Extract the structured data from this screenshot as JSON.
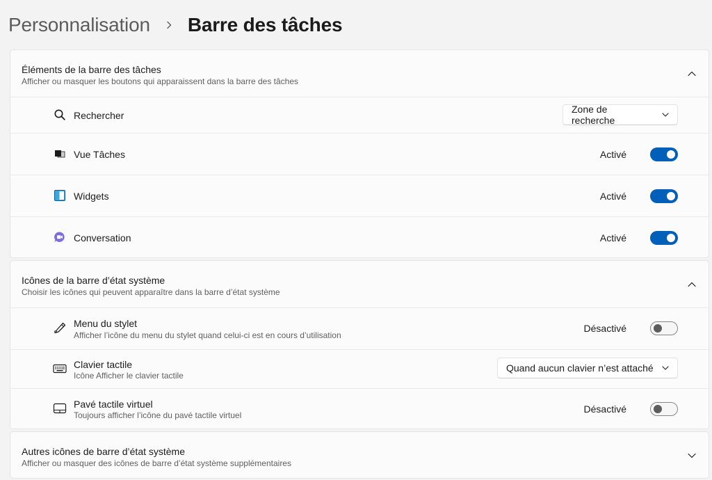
{
  "breadcrumb": {
    "parent": "Personnalisation",
    "current": "Barre des tâches"
  },
  "colors": {
    "accent": "#005fb8",
    "background": "#f3f3f3",
    "card": "#fbfbfb"
  },
  "sections": {
    "taskbar_items": {
      "title": "Éléments de la barre des tâches",
      "description": "Afficher ou masquer les boutons qui apparaissent dans la barre des tâches",
      "expanded": true,
      "rows": {
        "search": {
          "icon": "search-icon",
          "label": "Rechercher",
          "value": "Zone de recherche"
        },
        "task_view": {
          "icon": "task-view-icon",
          "label": "Vue Tâches",
          "state": "Activé",
          "on": true
        },
        "widgets": {
          "icon": "widgets-icon",
          "label": "Widgets",
          "state": "Activé",
          "on": true
        },
        "chat": {
          "icon": "chat-icon",
          "label": "Conversation",
          "state": "Activé",
          "on": true
        }
      }
    },
    "system_tray_icons": {
      "title": "Icônes de la barre d’état système",
      "description": "Choisir les icônes qui peuvent apparaître dans la barre d’état système",
      "expanded": true,
      "rows": {
        "pen_menu": {
          "icon": "pen-icon",
          "label": "Menu du stylet",
          "sub": "Afficher l’icône du menu du stylet quand celui-ci est en cours d’utilisation",
          "state": "Désactivé",
          "on": false
        },
        "touch_keyboard": {
          "icon": "keyboard-icon",
          "label": "Clavier tactile",
          "sub": "Icône Afficher le clavier tactile",
          "value": "Quand aucun clavier n’est attaché"
        },
        "virtual_touchpad": {
          "icon": "touchpad-icon",
          "label": "Pavé tactile virtuel",
          "sub": "Toujours afficher l’icône du pavé tactile virtuel",
          "state": "Désactivé",
          "on": false
        }
      }
    },
    "other_tray_icons": {
      "title": "Autres icônes de barre d’état système",
      "description": "Afficher ou masquer des icônes de barre d’état système supplémentaires",
      "expanded": false
    }
  }
}
